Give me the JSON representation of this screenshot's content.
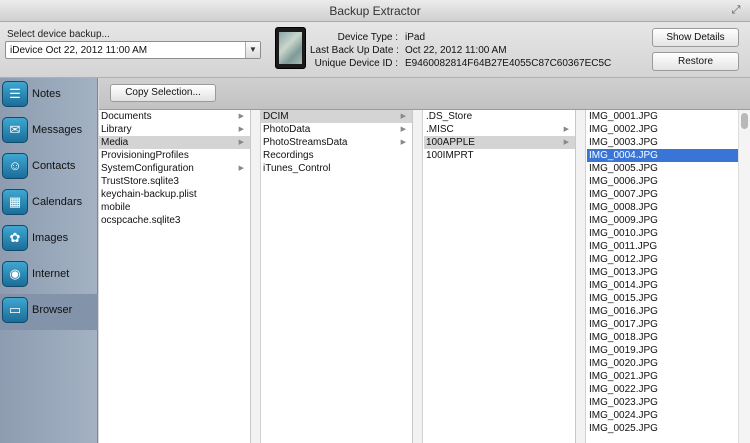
{
  "window": {
    "title": "Backup Extractor"
  },
  "header": {
    "select_label": "Select device backup...",
    "selected_backup": "iDevice Oct 22, 2012 11:00 AM",
    "device_type_label": "Device Type :",
    "device_type": "iPad",
    "last_backup_label": "Last Back Up Date :",
    "last_backup": "Oct 22, 2012 11:00 AM",
    "udid_label": "Unique Device ID :",
    "udid": "E9460082814F64B27E4055C87C60367EC5C",
    "show_details": "Show Details",
    "restore": "Restore"
  },
  "sidebar": {
    "items": [
      {
        "label": "Notes",
        "icon": "notes-icon"
      },
      {
        "label": "Messages",
        "icon": "messages-icon"
      },
      {
        "label": "Contacts",
        "icon": "contacts-icon"
      },
      {
        "label": "Calendars",
        "icon": "calendar-icon"
      },
      {
        "label": "Images",
        "icon": "images-icon"
      },
      {
        "label": "Internet",
        "icon": "internet-icon"
      },
      {
        "label": "Browser",
        "icon": "browser-icon"
      }
    ],
    "active": "Browser"
  },
  "toolbar": {
    "copy_selection": "Copy Selection..."
  },
  "browser": {
    "col1": [
      "Documents",
      "Library",
      "Media",
      "ProvisioningProfiles",
      "SystemConfiguration",
      "TrustStore.sqlite3",
      "keychain-backup.plist",
      "mobile",
      "ocspcache.sqlite3"
    ],
    "col2": [
      "DCIM",
      "PhotoData",
      "PhotoStreamsData",
      "Recordings",
      "iTunes_Control"
    ],
    "col3": [
      ".DS_Store",
      ".MISC",
      "100APPLE",
      "100IMPRT"
    ],
    "col4": [
      "IMG_0001.JPG",
      "IMG_0002.JPG",
      "IMG_0003.JPG",
      "IMG_0004.JPG",
      "IMG_0005.JPG",
      "IMG_0006.JPG",
      "IMG_0007.JPG",
      "IMG_0008.JPG",
      "IMG_0009.JPG",
      "IMG_0010.JPG",
      "IMG_0011.JPG",
      "IMG_0012.JPG",
      "IMG_0013.JPG",
      "IMG_0014.JPG",
      "IMG_0015.JPG",
      "IMG_0016.JPG",
      "IMG_0017.JPG",
      "IMG_0018.JPG",
      "IMG_0019.JPG",
      "IMG_0020.JPG",
      "IMG_0021.JPG",
      "IMG_0022.JPG",
      "IMG_0023.JPG",
      "IMG_0024.JPG",
      "IMG_0025.JPG"
    ]
  }
}
